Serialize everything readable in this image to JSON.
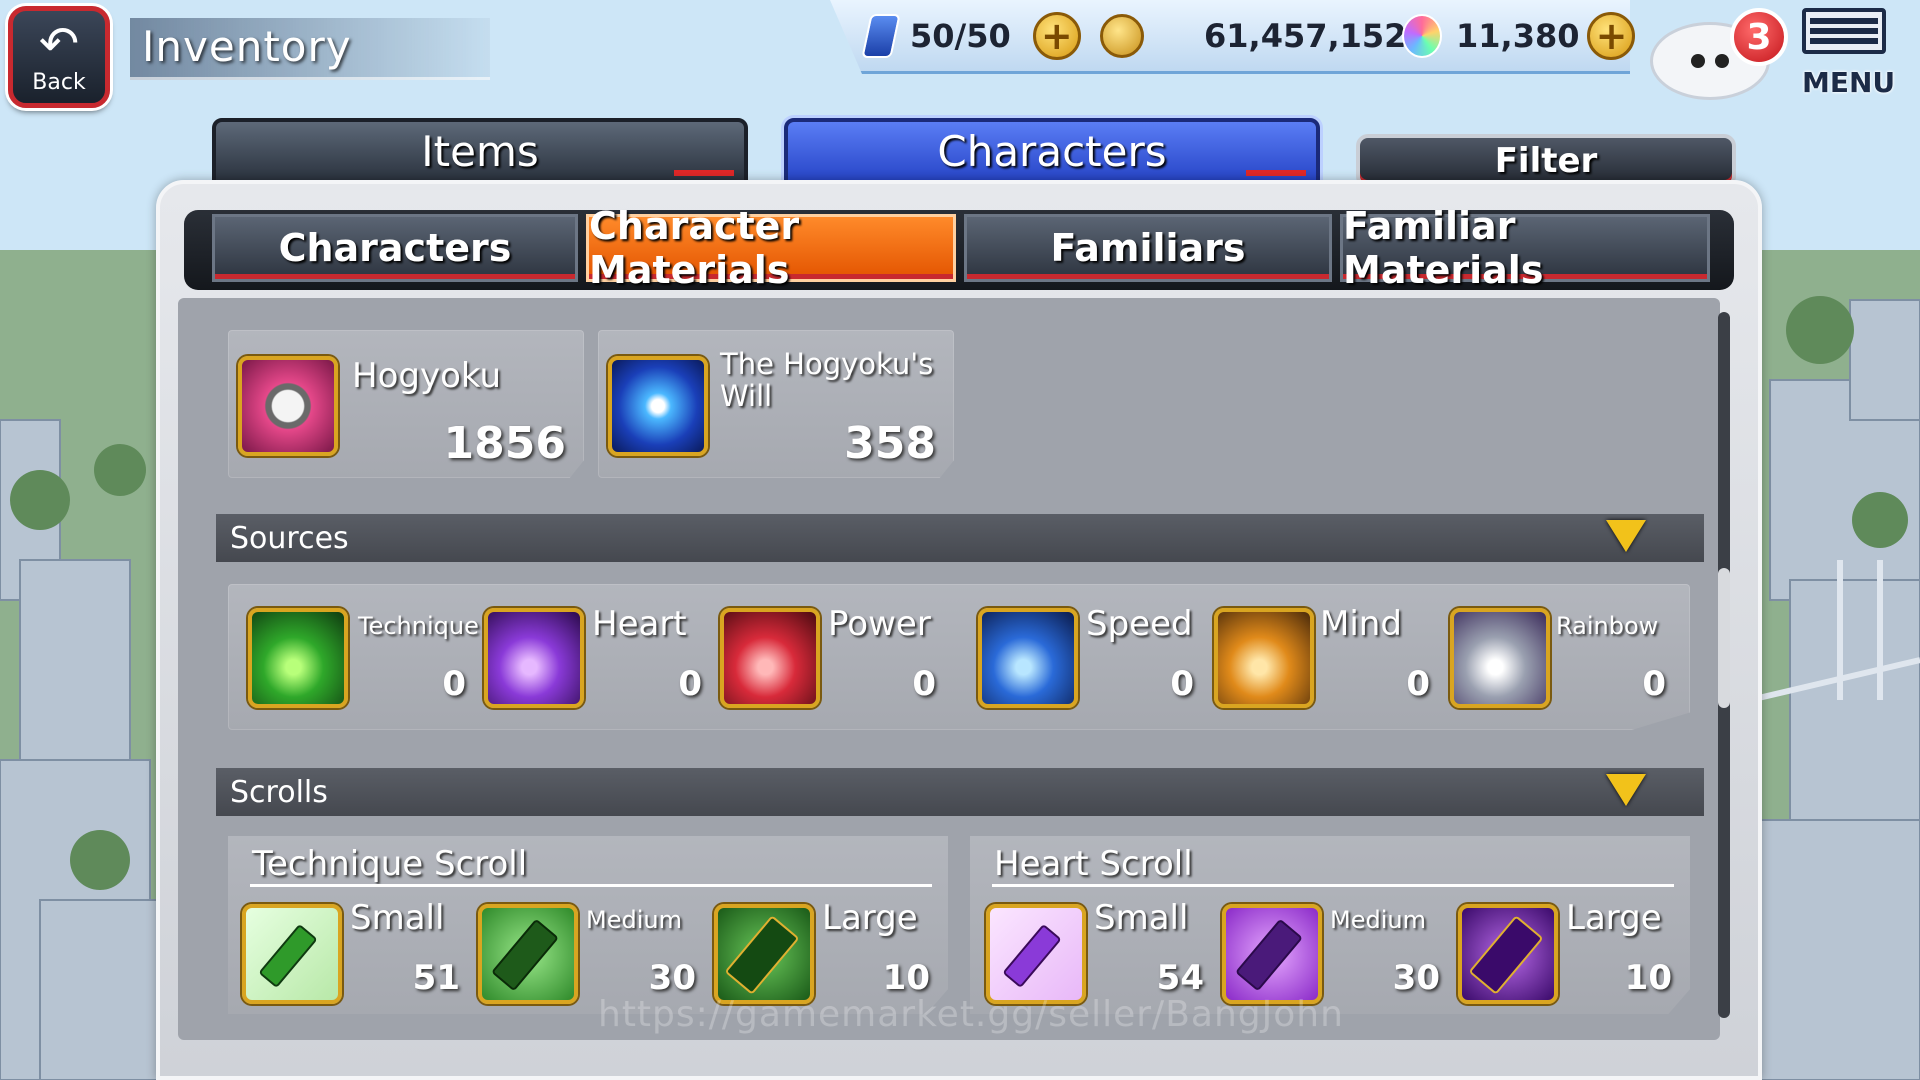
{
  "header": {
    "back_label": "Back",
    "back_arrow": "↶",
    "title": "Inventory"
  },
  "resources": {
    "stamina": {
      "icon": "stamina-card-icon",
      "value": "50/50"
    },
    "coins": {
      "icon": "coin-icon",
      "value": "61,457,152"
    },
    "orbs": {
      "icon": "spirit-orb-icon",
      "value": "11,380"
    },
    "plus": "+"
  },
  "notifications": {
    "count": "3"
  },
  "menu": {
    "label": "MENU"
  },
  "main_tabs": [
    {
      "label": "Items",
      "active": false
    },
    {
      "label": "Characters",
      "active": true
    }
  ],
  "filter": {
    "label": "Filter"
  },
  "sub_tabs": [
    {
      "label": "Characters",
      "active": false
    },
    {
      "label": "Character Materials",
      "active": true
    },
    {
      "label": "Familiars",
      "active": false
    },
    {
      "label": "Familiar Materials",
      "active": false
    }
  ],
  "hogyoku_items": [
    {
      "name": "Hogyoku",
      "count": "1856",
      "icon": "hogyoku-icon",
      "color": "#d9407a"
    },
    {
      "name": "The Hogyoku's Will",
      "count": "358",
      "icon": "hogyoku-will-icon",
      "color": "#2f8ee8"
    }
  ],
  "sources": {
    "title": "Sources",
    "items": [
      {
        "name": "Technique",
        "count": "0",
        "icon": "technique-source-icon",
        "color": "#2fa82a"
      },
      {
        "name": "Heart",
        "count": "0",
        "icon": "heart-source-icon",
        "color": "#8a3ad8"
      },
      {
        "name": "Power",
        "count": "0",
        "icon": "power-source-icon",
        "color": "#d82a3a"
      },
      {
        "name": "Speed",
        "count": "0",
        "icon": "speed-source-icon",
        "color": "#2a6ad8"
      },
      {
        "name": "Mind",
        "count": "0",
        "icon": "mind-source-icon",
        "color": "#e08a1a"
      },
      {
        "name": "Rainbow",
        "count": "0",
        "icon": "rainbow-source-icon",
        "color": "#9aa0b0"
      }
    ]
  },
  "scrolls": {
    "title": "Scrolls",
    "groups": [
      {
        "title": "Technique Scroll",
        "color": "#2f9a2a",
        "items": [
          {
            "name": "Small",
            "count": "51",
            "icon": "technique-scroll-small-icon"
          },
          {
            "name": "Medium",
            "count": "30",
            "icon": "technique-scroll-medium-icon"
          },
          {
            "name": "Large",
            "count": "10",
            "icon": "technique-scroll-large-icon"
          }
        ]
      },
      {
        "title": "Heart Scroll",
        "color": "#9a3ad8",
        "items": [
          {
            "name": "Small",
            "count": "54",
            "icon": "heart-scroll-small-icon"
          },
          {
            "name": "Medium",
            "count": "30",
            "icon": "heart-scroll-medium-icon"
          },
          {
            "name": "Large",
            "count": "10",
            "icon": "heart-scroll-large-icon"
          }
        ]
      }
    ]
  },
  "watermark": "https://gamemarket.gg/seller/BangJohn"
}
